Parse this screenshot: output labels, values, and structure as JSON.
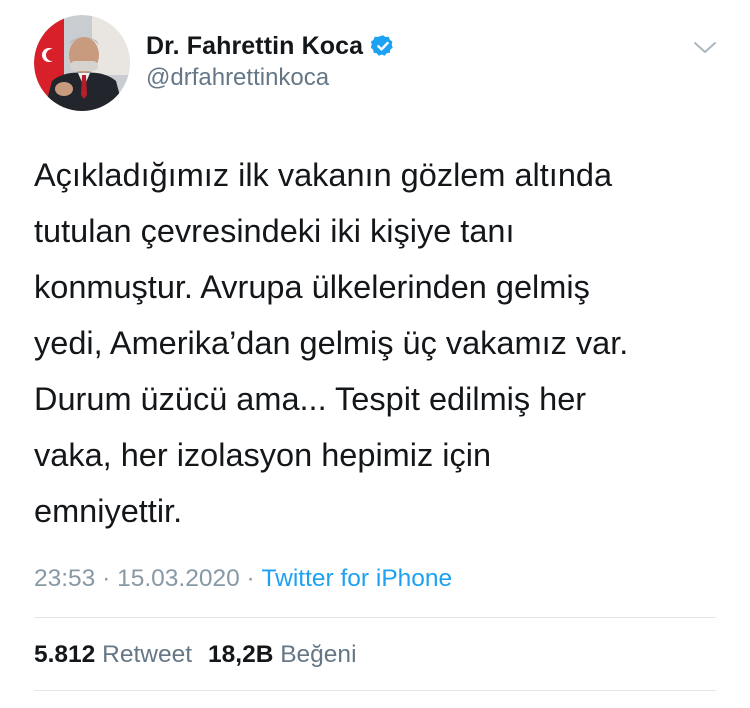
{
  "author": {
    "display_name": "Dr. Fahrettin Koca",
    "handle": "@drfahrettinkoca",
    "verified": true,
    "avatar_icon": "profile-photo"
  },
  "tweet": {
    "text": "Açıkladığımız ilk vakanın gözlem altında\ntutulan çevresindeki iki kişiye tanı\nkonmuştur. Avrupa ülkelerinden gelmiş\nyedi, Amerika’dan gelmiş üç vakamız var.\nDurum üzücü ama... Tespit edilmiş her\nvaka, her izolasyon hepimiz için\nemniyettir.",
    "time": "23:53",
    "separator": "·",
    "date": "15.03.2020",
    "source": "Twitter for iPhone"
  },
  "stats": {
    "retweets_count": "5.812",
    "retweets_label": "Retweet",
    "likes_count": "18,2B",
    "likes_label": "Beğeni"
  },
  "colors": {
    "primary_text": "#14171a",
    "secondary_text": "#657786",
    "meta_text": "#8899a6",
    "link": "#1da1f2",
    "verified_badge": "#1da1f2",
    "divider": "#e1e8ed"
  },
  "icons": {
    "verified": "verified-badge-icon",
    "menu": "chevron-down-icon"
  }
}
